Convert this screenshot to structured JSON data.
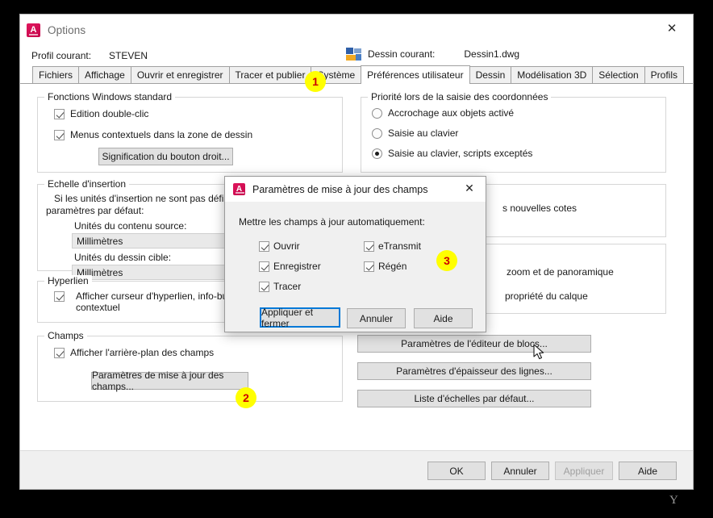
{
  "window": {
    "title": "Options",
    "app_icon": "autocad-icon",
    "close_label": "✕"
  },
  "header": {
    "profile_label": "Profil courant:",
    "profile_value": "STEVEN",
    "drawing_icon": "drawing-icon",
    "drawing_label": "Dessin courant:",
    "drawing_value": "Dessin1.dwg"
  },
  "tabs": [
    {
      "label": "Fichiers",
      "active": false
    },
    {
      "label": "Affichage",
      "active": false
    },
    {
      "label": "Ouvrir et enregistrer",
      "active": false
    },
    {
      "label": "Tracer et publier",
      "active": false
    },
    {
      "label": "Système",
      "active": false
    },
    {
      "label": "Préférences utilisateur",
      "active": true
    },
    {
      "label": "Dessin",
      "active": false
    },
    {
      "label": "Modélisation 3D",
      "active": false
    },
    {
      "label": "Sélection",
      "active": false
    },
    {
      "label": "Profils",
      "active": false
    }
  ],
  "groups": {
    "windows_standard": {
      "legend": "Fonctions Windows standard",
      "checkbox_double_click": "Edition double-clic",
      "checkbox_context_menus": "Menus contextuels dans la zone de dessin",
      "button_right_click": "Signification du bouton droit..."
    },
    "coordinate_priority": {
      "legend": "Priorité lors de la saisie des coordonnées",
      "radios": [
        {
          "label": "Accrochage aux objets activé",
          "selected": false
        },
        {
          "label": "Saisie au clavier",
          "selected": false
        },
        {
          "label": "Saisie au clavier, scripts exceptés",
          "selected": true
        }
      ]
    },
    "insertion_scale": {
      "legend": "Echelle d'insertion",
      "description_line1": "Si les unités d'insertion ne sont pas définies, u",
      "description_line2": "paramètres par défaut:",
      "source_units_label": "Unités du contenu source:",
      "source_units_value": "Millimètres",
      "target_units_label": "Unités du dessin cible:",
      "target_units_value": "Millimètres"
    },
    "hyperlink": {
      "legend": "Hyperlien",
      "checkbox_line1": "Afficher curseur d'hyperlien, info-bulle et me",
      "checkbox_line2": "contextuel"
    },
    "fields": {
      "legend": "Champs",
      "checkbox_background": "Afficher l'arrière-plan des champs",
      "button_update_settings": "Paramètres de mise à jour des champs..."
    },
    "right_partial_1": {
      "text": "s nouvelles cotes"
    },
    "right_partial_2": {
      "text_line1": "zoom et de panoramique",
      "text_line2": "propriété du calque"
    }
  },
  "right_buttons": [
    {
      "label": "Paramètres de l'éditeur de blocs..."
    },
    {
      "label": "Paramètres d'épaisseur des lignes..."
    },
    {
      "label": "Liste d'échelles par défaut..."
    }
  ],
  "footer": {
    "ok": "OK",
    "cancel": "Annuler",
    "apply": "Appliquer",
    "apply_disabled": true,
    "help": "Aide"
  },
  "modal": {
    "title": "Paramètres de mise à jour des champs",
    "app_icon": "autocad-icon",
    "close_label": "✕",
    "instruction": "Mettre les champs à jour automatiquement:",
    "checkboxes": [
      {
        "label": "Ouvrir",
        "checked": true
      },
      {
        "label": "Enregistrer",
        "checked": true
      },
      {
        "label": "Tracer",
        "checked": true
      },
      {
        "label": "eTransmit",
        "checked": true
      },
      {
        "label": "Régén",
        "checked": true
      }
    ],
    "buttons": [
      {
        "label": "Appliquer et fermer",
        "default": true
      },
      {
        "label": "Annuler",
        "default": false
      },
      {
        "label": "Aide",
        "default": false
      }
    ]
  },
  "badges": [
    {
      "number": "1"
    },
    {
      "number": "2"
    },
    {
      "number": "3"
    }
  ],
  "colors": {
    "badge_fill": "#ffff00",
    "badge_text": "#cc0000",
    "accent_blue": "#0078d7",
    "acad_red": "#e0165c",
    "window_bg": "#ffffff",
    "dialog_bg": "#f0f0f0",
    "desktop_bg": "#000000"
  },
  "artifact": {
    "glyph": "Y"
  }
}
